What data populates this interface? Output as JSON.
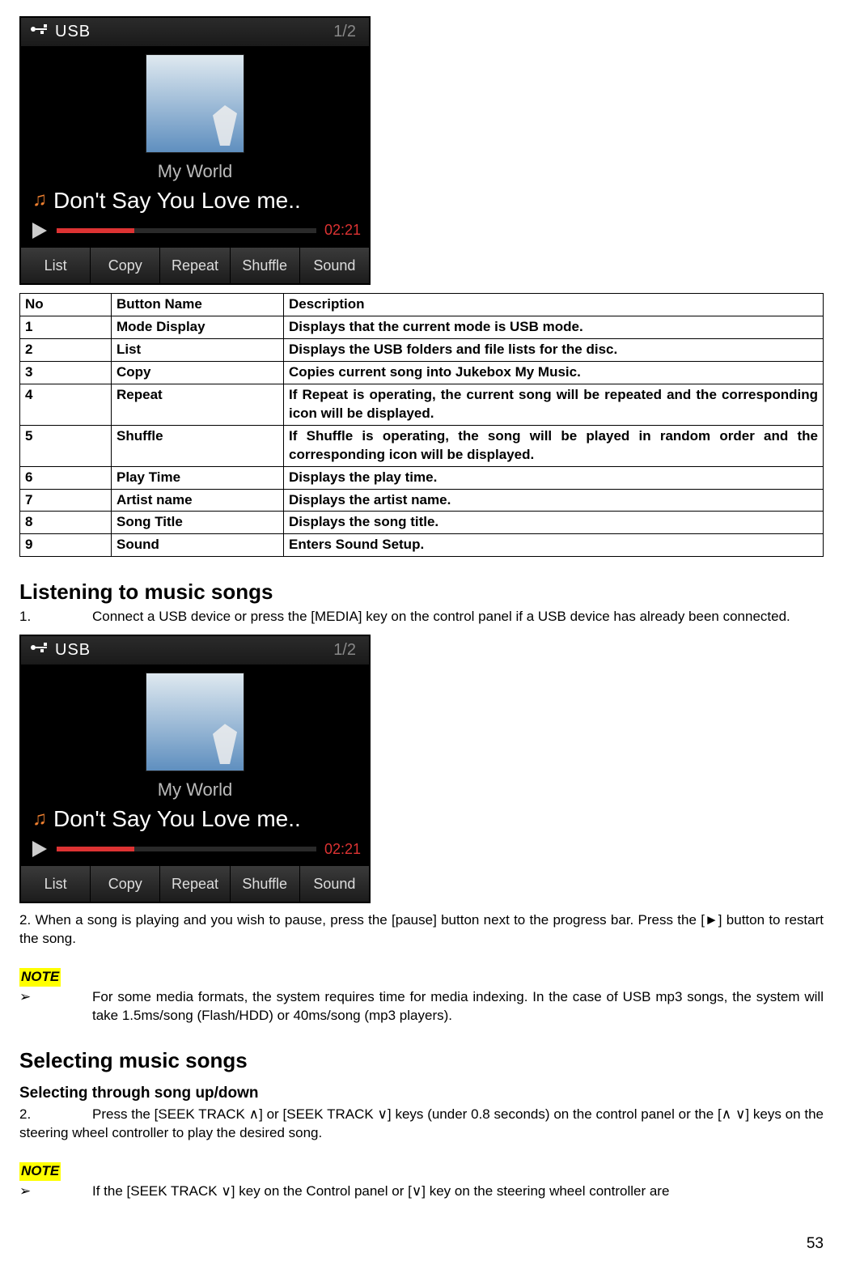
{
  "player": {
    "mode": "USB",
    "track_counter": "1/2",
    "artist": "My World",
    "title": "Don't Say You Love me..",
    "play_time": "02:21",
    "buttons": {
      "list": "List",
      "copy": "Copy",
      "repeat": "Repeat",
      "shuffle": "Shuffle",
      "sound": "Sound"
    }
  },
  "table": {
    "head": {
      "no": "No",
      "name": "Button Name",
      "desc": "Description"
    },
    "rows": [
      {
        "no": "1",
        "name": "Mode Display",
        "desc": "Displays that the current mode is USB mode."
      },
      {
        "no": "2",
        "name": "List",
        "desc": "Displays the USB folders and file lists for the disc."
      },
      {
        "no": "3",
        "name": "Copy",
        "desc": "Copies current song into Jukebox My Music."
      },
      {
        "no": "4",
        "name": "Repeat",
        "desc": "If Repeat is operating, the current song will be repeated and the corresponding icon will be displayed."
      },
      {
        "no": "5",
        "name": "Shuffle",
        "desc": "If Shuffle is operating, the song will be played in random order and the corresponding icon will be displayed."
      },
      {
        "no": "6",
        "name": "Play Time",
        "desc": "Displays the play time."
      },
      {
        "no": "7",
        "name": "Artist name",
        "desc": "Displays the artist name."
      },
      {
        "no": "8",
        "name": "Song Title",
        "desc": "Displays the song title."
      },
      {
        "no": "9",
        "name": "Sound",
        "desc": "Enters Sound Setup."
      }
    ]
  },
  "sections": {
    "listening": {
      "heading": "Listening to music songs",
      "step1_num": "1.",
      "step1": "Connect a USB device or press the [MEDIA] key on the control panel if a USB device has already been connected.",
      "step2": "2. When a song is playing and you wish to pause, press the [pause] button next to the progress bar. Press the [►] button to restart the song.",
      "note_label": "NOTE",
      "note_bullet": "➢",
      "note_body": "For some media formats, the system requires time for media indexing. In the case of USB mp3 songs, the system will take 1.5ms/song (Flash/HDD) or 40ms/song (mp3 players)."
    },
    "selecting": {
      "heading": "Selecting music songs",
      "sub": "Selecting through song up/down",
      "step2_num": "2.",
      "step2": "Press the [SEEK TRACK ∧] or [SEEK TRACK ∨] keys (under 0.8 seconds) on the control panel or the [∧ ∨] keys on the steering wheel controller to play the desired song.",
      "note_label": "NOTE",
      "note_bullet": "➢",
      "note_body": "If the [SEEK TRACK ∨] key on the Control panel or [∨] key on the steering wheel controller are"
    }
  },
  "page_number": "53"
}
